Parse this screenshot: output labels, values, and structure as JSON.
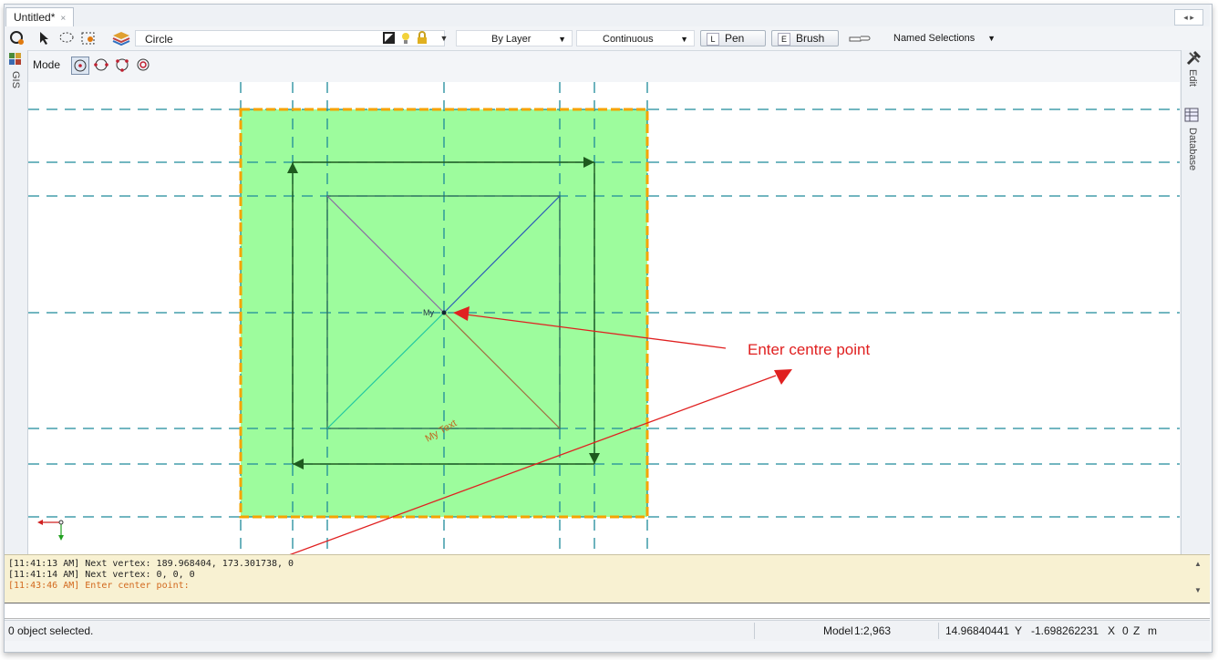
{
  "document_tab": {
    "title": "Untitled*",
    "close": "×"
  },
  "tab_nav": "◂ ▸",
  "toolbar": {
    "shape_name": "Circle",
    "color_combo": "By Layer",
    "linetype_combo": "Continuous",
    "pen_key": "L",
    "pen_label": "Pen",
    "brush_key": "E",
    "brush_label": "Brush",
    "named_selections": "Named Selections"
  },
  "modebar": {
    "label": "Mode"
  },
  "left_panel": {
    "gis_tab": "GIS"
  },
  "right_panel": {
    "edit_tab": "Edit",
    "database_tab": "Database"
  },
  "canvas": {
    "center_label": "My",
    "rotated_text": "My Text",
    "annotation": "Enter centre point",
    "fill_color": "#9dfc9d",
    "border_color": "#f5a300",
    "annotation_color": "#e02020",
    "grid_color": "#1e8a9a"
  },
  "log": {
    "lines": [
      "[11:41:13 AM] Next vertex: 189.968404, 173.301738, 0",
      "[11:41:14 AM] Next vertex: 0, 0, 0",
      "[11:43:46 AM] Enter center point:"
    ]
  },
  "status": {
    "selection": "0 object selected.",
    "space": "Model",
    "scale": "1:2,963",
    "coord_y_value": "14.96840441",
    "coord_y_label": "Y",
    "coord_x_value": "-1.698262231",
    "coord_x_label": "X",
    "coord_z_value": "0",
    "coord_z_label": "Z",
    "unit": "m"
  }
}
